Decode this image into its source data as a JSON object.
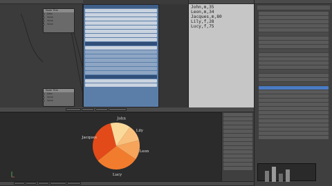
{
  "colors": {
    "editor_bg": "#3b3b3b",
    "node_bg": "#6a6a6a",
    "panel_blue": "#5b7ea8",
    "text_editor_bg": "#c6c6c6",
    "chart_bg": "#2b2b2b",
    "pie": [
      "#e24a1a",
      "#f27c2e",
      "#f6a45a",
      "#f8c07c",
      "#fad99b"
    ]
  },
  "node_editor": {
    "nodes": [
      {
        "title": "Node Title",
        "rows": [
          "Data",
          "Value",
          "Value",
          "Value"
        ]
      },
      {
        "title": "Node Title",
        "rows": [
          "Data",
          "Value",
          "Value",
          "Value"
        ]
      }
    ]
  },
  "text_editor": {
    "lines": [
      "John,m,35",
      "Leon,m,34",
      "Jacques,m,80",
      "Lily,f,28",
      "Lucy,f,75"
    ]
  },
  "chart_data": {
    "type": "pie",
    "title": "",
    "categories": [
      "John",
      "Lily",
      "Leon",
      "Lucy",
      "Jacques"
    ],
    "values": [
      35,
      28,
      34,
      75,
      80
    ],
    "series": [
      {
        "values": [
          35,
          28,
          34,
          75,
          80
        ]
      }
    ]
  }
}
